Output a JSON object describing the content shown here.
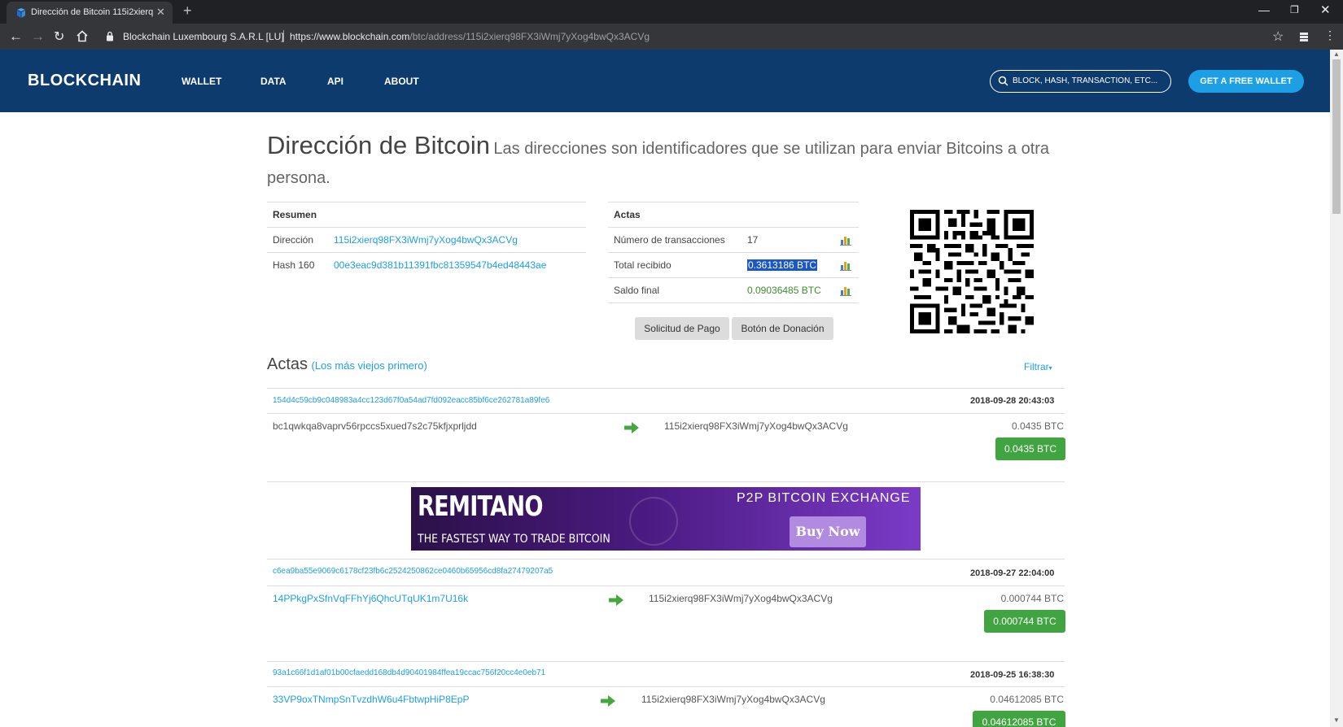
{
  "browser": {
    "tab_title": "Dirección de Bitcoin 115i2xierq9€",
    "site_identity": "Blockchain Luxembourg S.A.R.L [LU]",
    "url_scheme_host": "https://www.blockchain.com",
    "url_path": "/btc/address/115i2xierq98FX3iWmj7yXog4bwQx3ACVg"
  },
  "header": {
    "logo": "BLOCKCHAIN",
    "nav": [
      "WALLET",
      "DATA",
      "API",
      "ABOUT"
    ],
    "search_placeholder": "BLOCK, HASH, TRANSACTION, ETC...",
    "cta": "GET A FREE WALLET"
  },
  "page": {
    "title": "Dirección de Bitcoin",
    "subtitle": "Las direcciones son identificadores que se utilizan para enviar Bitcoins a otra persona."
  },
  "summary": {
    "heading": "Resumen",
    "rows": [
      {
        "label": "Dirección",
        "value": "115i2xierq98FX3iWmj7yXog4bwQx3ACVg"
      },
      {
        "label": "Hash 160",
        "value": "00e3eac9d381b11391fbc81359547b4ed48443ae"
      }
    ]
  },
  "actas": {
    "heading": "Actas",
    "rows": [
      {
        "label": "Número de transacciones",
        "value": "17"
      },
      {
        "label": "Total recibido",
        "value": "0.3613186 BTC"
      },
      {
        "label": "Saldo final",
        "value": "0.09036485 BTC"
      }
    ],
    "buttons": [
      "Solicitud de Pago",
      "Botón de Donación"
    ]
  },
  "transactions_section": {
    "title": "Actas",
    "order": "(Los más viejos primero)",
    "filter": "Filtrar"
  },
  "transactions": [
    {
      "hash": "154d4c59cb9c048983a4cc123d67f0a54ad7fd092eacc85bf6ce262781a89fe6",
      "date": "2018-09-28 20:43:03",
      "from": "bc1qwkqa8vaprv56rpccs5xued7s2c75kfjxprljdd",
      "to": "115i2xierq98FX3iWmj7yXog4bwQx3ACVg",
      "amount": "0.0435 BTC",
      "total": "0.0435 BTC"
    },
    {
      "hash": "c6ea9ba55e9069c6178cf23fb6c2524250862ce0460b65956cd8fa27479207a5",
      "date": "2018-09-27 22:04:00",
      "from": "14PPkgPxSfnVqFFhYj6QhcUTqUK1m7U16k",
      "to": "115i2xierq98FX3iWmj7yXog4bwQx3ACVg",
      "amount": "0.000744 BTC",
      "total": "0.000744 BTC"
    },
    {
      "hash": "93a1c66f1d1af01b00cfaedd168db4d90401984ffea19ccac756f20cc4e0eb71",
      "date": "2018-09-25 16:38:30",
      "from": "33VP9oxTNmpSnTvzdhW6u4FbtwpHiP8EpP",
      "to": "115i2xierq98FX3iWmj7yXog4bwQx3ACVg",
      "amount": "0.04612085 BTC",
      "total": "0.04612085 BTC"
    }
  ],
  "banner": {
    "brand": "REMITANO",
    "tagline": "THE FASTEST WAY TO TRADE BITCOIN",
    "headline": "P2P BITCOIN EXCHANGE",
    "button": "Buy Now"
  },
  "colors": {
    "header_bg": "#0e3b6d",
    "accent_blue": "#1c9fe5",
    "btc_green": "#40a540"
  }
}
